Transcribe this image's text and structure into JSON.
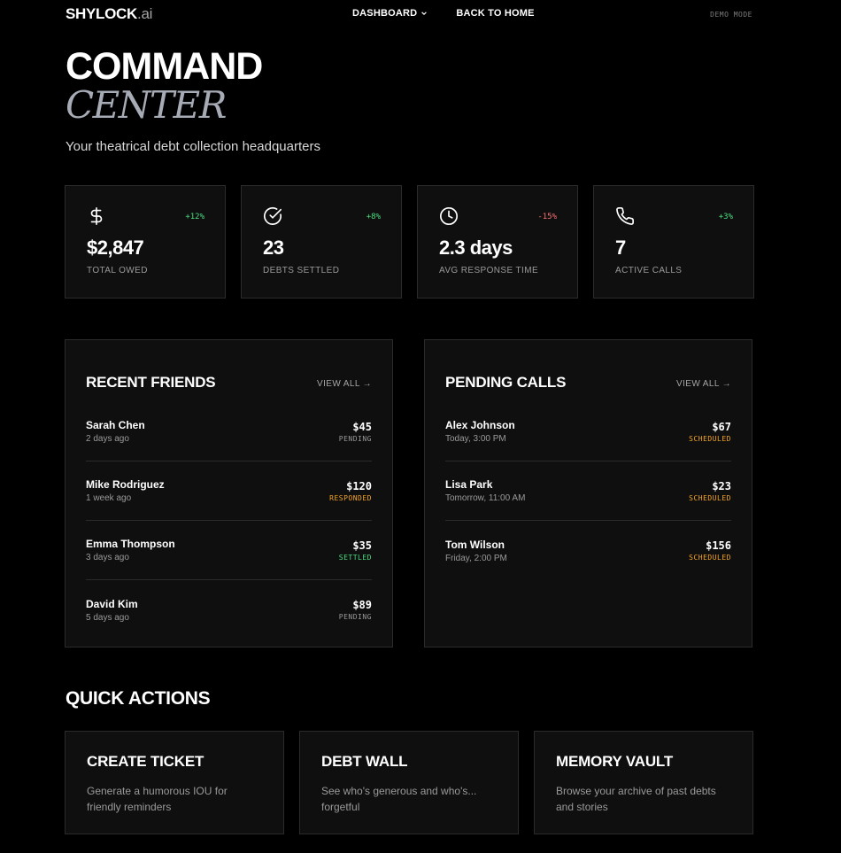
{
  "header": {
    "logo_main": "SHYLOCK",
    "logo_suffix": ".ai",
    "nav": [
      {
        "label": "DASHBOARD",
        "icon": "chevron-down-icon"
      },
      {
        "label": "BACK TO HOME"
      }
    ],
    "mode_badge": "DEMO MODE"
  },
  "hero": {
    "title_line1": "COMMAND",
    "title_line2": "CENTER",
    "subtitle": "Your theatrical debt collection headquarters"
  },
  "stats": [
    {
      "icon": "dollar-icon",
      "change": "+12%",
      "change_color": "#4ade80",
      "value": "$2,847",
      "label": "TOTAL OWED"
    },
    {
      "icon": "check-circle-icon",
      "change": "+8%",
      "change_color": "#4ade80",
      "value": "23",
      "label": "DEBTS SETTLED"
    },
    {
      "icon": "clock-icon",
      "change": "-15%",
      "change_color": "#f87171",
      "value": "2.3 days",
      "label": "AVG RESPONSE TIME"
    },
    {
      "icon": "phone-icon",
      "change": "+3%",
      "change_color": "#4ade80",
      "value": "7",
      "label": "ACTIVE CALLS"
    }
  ],
  "recent_friends": {
    "title": "RECENT FRIENDS",
    "link": "VIEW ALL →",
    "rows": [
      {
        "name": "Sarah Chen",
        "when": "2 days ago",
        "amount": "$45",
        "status": "PENDING",
        "status_color": "#9a9a9a"
      },
      {
        "name": "Mike Rodriguez",
        "when": "1 week ago",
        "amount": "$120",
        "status": "RESPONDED",
        "status_color": "#f5a524"
      },
      {
        "name": "Emma Thompson",
        "when": "3 days ago",
        "amount": "$35",
        "status": "SETTLED",
        "status_color": "#4ade80"
      },
      {
        "name": "David Kim",
        "when": "5 days ago",
        "amount": "$89",
        "status": "PENDING",
        "status_color": "#9a9a9a"
      }
    ]
  },
  "pending_calls": {
    "title": "PENDING CALLS",
    "link": "VIEW ALL →",
    "rows": [
      {
        "name": "Alex Johnson",
        "when": "Today, 3:00 PM",
        "amount": "$67",
        "status": "SCHEDULED",
        "status_color": "#f5a524"
      },
      {
        "name": "Lisa Park",
        "when": "Tomorrow, 11:00 AM",
        "amount": "$23",
        "status": "SCHEDULED",
        "status_color": "#f5a524"
      },
      {
        "name": "Tom Wilson",
        "when": "Friday, 2:00 PM",
        "amount": "$156",
        "status": "SCHEDULED",
        "status_color": "#f5a524"
      }
    ]
  },
  "quick_actions": {
    "title": "QUICK ACTIONS",
    "items": [
      {
        "title": "CREATE TICKET",
        "desc": "Generate a humorous IOU for friendly reminders"
      },
      {
        "title": "DEBT WALL",
        "desc": "See who's generous and who's... forgetful"
      },
      {
        "title": "MEMORY VAULT",
        "desc": "Browse your archive of past debts and stories"
      }
    ]
  }
}
